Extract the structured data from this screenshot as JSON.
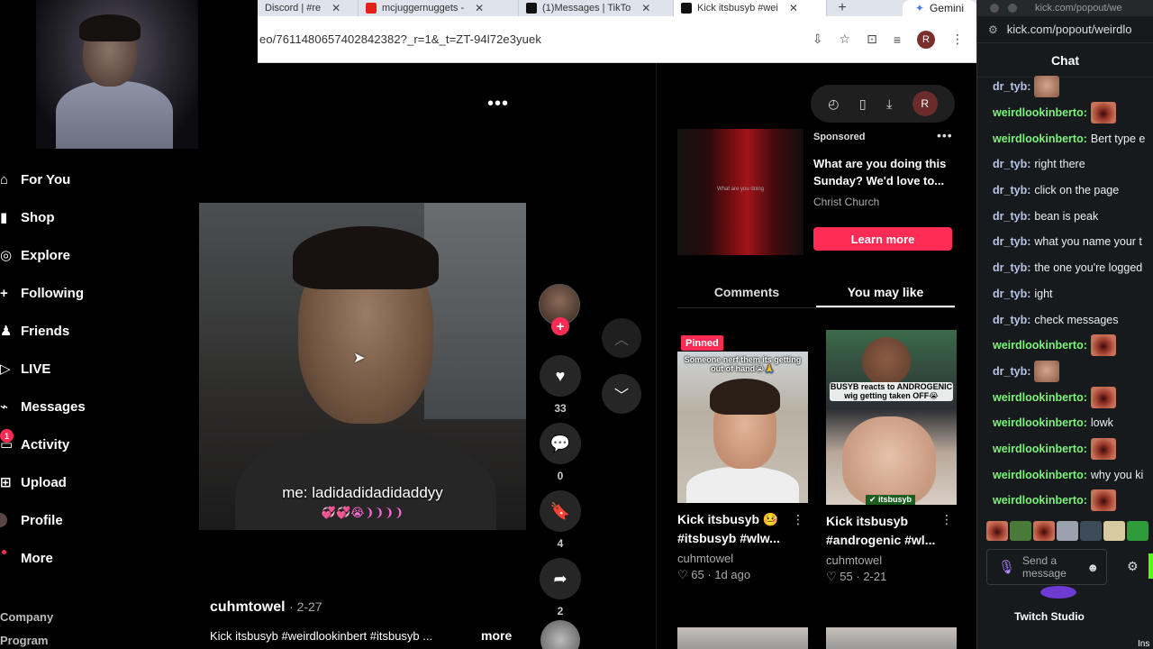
{
  "browser": {
    "tabs": [
      {
        "title": "Discord | #re",
        "icon": "discord-icon",
        "active": false
      },
      {
        "title": "mcjuggernuggets -",
        "icon": "youtube-icon",
        "active": false
      },
      {
        "title": "(1)Messages | TikTo",
        "icon": "tiktok-icon",
        "active": false
      },
      {
        "title": "Kick itsbusyb #wei",
        "icon": "tiktok-icon",
        "active": true
      }
    ],
    "new_tab": "+",
    "gemini_label": "Gemini",
    "url": "eo/7611480657402842382?_r=1&_t=ZT-94l72e3yuek",
    "profile_initial": "R"
  },
  "leftnav": {
    "items": [
      {
        "label": "For You",
        "icon": "home-icon",
        "glyph": "⌂"
      },
      {
        "label": "Shop",
        "icon": "shop-icon",
        "glyph": "▮"
      },
      {
        "label": "Explore",
        "icon": "compass-icon",
        "glyph": "◎"
      },
      {
        "label": "Following",
        "icon": "following-icon",
        "glyph": "+"
      },
      {
        "label": "Friends",
        "icon": "friends-icon",
        "glyph": "♟"
      },
      {
        "label": "LIVE",
        "icon": "live-icon",
        "glyph": "▷"
      },
      {
        "label": "Messages",
        "icon": "messages-icon",
        "glyph": "⌁"
      },
      {
        "label": "Activity",
        "icon": "activity-icon",
        "glyph": "▭",
        "badge": "1"
      },
      {
        "label": "Upload",
        "icon": "upload-icon",
        "glyph": "⊞"
      },
      {
        "label": "Profile",
        "icon": "profile-avatar",
        "glyph": ""
      },
      {
        "label": "More",
        "icon": "more-icon",
        "glyph": "•",
        "dot": true
      }
    ],
    "footer": [
      "Company",
      "Program"
    ]
  },
  "video": {
    "caption": "me: ladidadidadidaddyy",
    "caption_emojis": "💞💞😭❩❩❩❩",
    "author": "cuhmtowel",
    "date": "· 2-27",
    "description": "Kick itsbusyb #weirdlookinbert #itsbusyb ...",
    "more": "more",
    "likes": "33",
    "comments": "0",
    "saves": "4",
    "shares": "2",
    "follow_plus": "+"
  },
  "sidebar_right": {
    "ad": {
      "thumb_text": "What are you doing",
      "sponsored": "Sponsored",
      "title": "What are you doing this Sunday? We'd love to...",
      "brand": "Christ Church",
      "cta": "Learn more"
    },
    "tabs": [
      {
        "label": "Comments",
        "active": false
      },
      {
        "label": "You may like",
        "active": true
      }
    ],
    "pinned_label": "Pinned",
    "cards": [
      {
        "overlay": "Someone nerf them its getting out of hand😭🙏",
        "title": "Kick itsbusyb 🤒 #itsbusyb #wlw...",
        "author": "cuhmtowel",
        "likes": "65",
        "date": "1d ago"
      },
      {
        "overlay": "BUSYB reacts to ANDROGENIC wig getting taken OFF😭",
        "tag": "✔ itsbusyb",
        "title": "Kick itsbusyb #androgenic #wl...",
        "author": "cuhmtowel",
        "likes": "55",
        "date": "2-21"
      }
    ],
    "pill_initial": "R"
  },
  "kick": {
    "domain_tab": "kick.com/popout/we",
    "url": "kick.com/popout/weirdlo",
    "header": "Chat",
    "messages": [
      {
        "user": "dr_tyb:",
        "color": "blue",
        "text": "",
        "emote": "man"
      },
      {
        "user": "weirdlookinberto:",
        "color": "green",
        "text": "",
        "emote": "mouth"
      },
      {
        "user": "weirdlookinberto:",
        "color": "green",
        "text": "Bert type e",
        "emote": ""
      },
      {
        "user": "dr_tyb:",
        "color": "blue",
        "text": "right there",
        "emote": ""
      },
      {
        "user": "dr_tyb:",
        "color": "blue",
        "text": "click on the page",
        "emote": ""
      },
      {
        "user": "dr_tyb:",
        "color": "blue",
        "text": "bean is peak",
        "emote": ""
      },
      {
        "user": "dr_tyb:",
        "color": "blue",
        "text": "what you name your t",
        "emote": ""
      },
      {
        "user": "dr_tyb:",
        "color": "blue",
        "text": "the one you're logged",
        "emote": ""
      },
      {
        "user": "dr_tyb:",
        "color": "blue",
        "text": "ight",
        "emote": ""
      },
      {
        "user": "dr_tyb:",
        "color": "blue",
        "text": "check messages",
        "emote": ""
      },
      {
        "user": "weirdlookinberto:",
        "color": "green",
        "text": "",
        "emote": "mouth"
      },
      {
        "user": "dr_tyb:",
        "color": "blue",
        "text": "",
        "emote": "man"
      },
      {
        "user": "weirdlookinberto:",
        "color": "green",
        "text": "",
        "emote": "mouth"
      },
      {
        "user": "weirdlookinberto:",
        "color": "green",
        "text": "lowk",
        "emote": ""
      },
      {
        "user": "weirdlookinberto:",
        "color": "green",
        "text": "",
        "emote": "mouth"
      },
      {
        "user": "weirdlookinberto:",
        "color": "green",
        "text": "why you ki",
        "emote": ""
      },
      {
        "user": "weirdlookinberto:",
        "color": "green",
        "text": "",
        "emote": "mouth"
      }
    ],
    "input_placeholder": "Send a message",
    "twitch_studio": "Twitch Studio",
    "ins": "Ins",
    "colors": {
      "blue_user": "#b7c4e8",
      "green_user": "#7cf27a",
      "kick_green": "#53fc18"
    }
  },
  "colors": {
    "accent": "#fe2c55",
    "background": "#000000"
  }
}
